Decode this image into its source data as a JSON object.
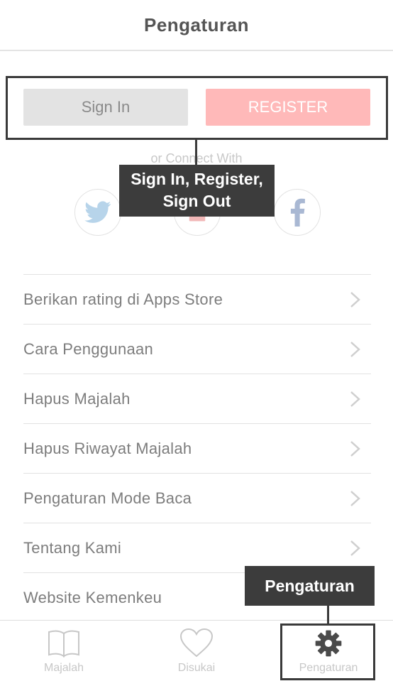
{
  "header": {
    "title": "Pengaturan"
  },
  "auth": {
    "signin_label": "Sign In",
    "register_label": "REGISTER"
  },
  "connect": {
    "text": "or Connect With",
    "icons": [
      "twitter-icon",
      "google-icon",
      "facebook-icon"
    ]
  },
  "menu": {
    "items": [
      {
        "label": "Berikan rating di Apps Store"
      },
      {
        "label": "Cara Penggunaan"
      },
      {
        "label": "Hapus Majalah"
      },
      {
        "label": "Hapus Riwayat Majalah"
      },
      {
        "label": "Pengaturan Mode Baca"
      },
      {
        "label": "Tentang Kami"
      },
      {
        "label": "Website Kemenkeu"
      }
    ]
  },
  "tabbar": {
    "tabs": [
      {
        "label": "Majalah",
        "icon": "book-icon"
      },
      {
        "label": "Disukai",
        "icon": "heart-icon"
      },
      {
        "label": "Pengaturan",
        "icon": "gear-icon",
        "active": true
      }
    ]
  },
  "annotations": {
    "auth_line1": "Sign In, Register,",
    "auth_line2": "Sign Out",
    "settings": "Pengaturan"
  },
  "colors": {
    "register_bg": "#ffb9b9",
    "signin_bg": "#e3e3e3",
    "annotation_bg": "#3c3c3c",
    "active_tab_icon": "#4a4a4a",
    "inactive_tab": "#c7c7c7"
  }
}
